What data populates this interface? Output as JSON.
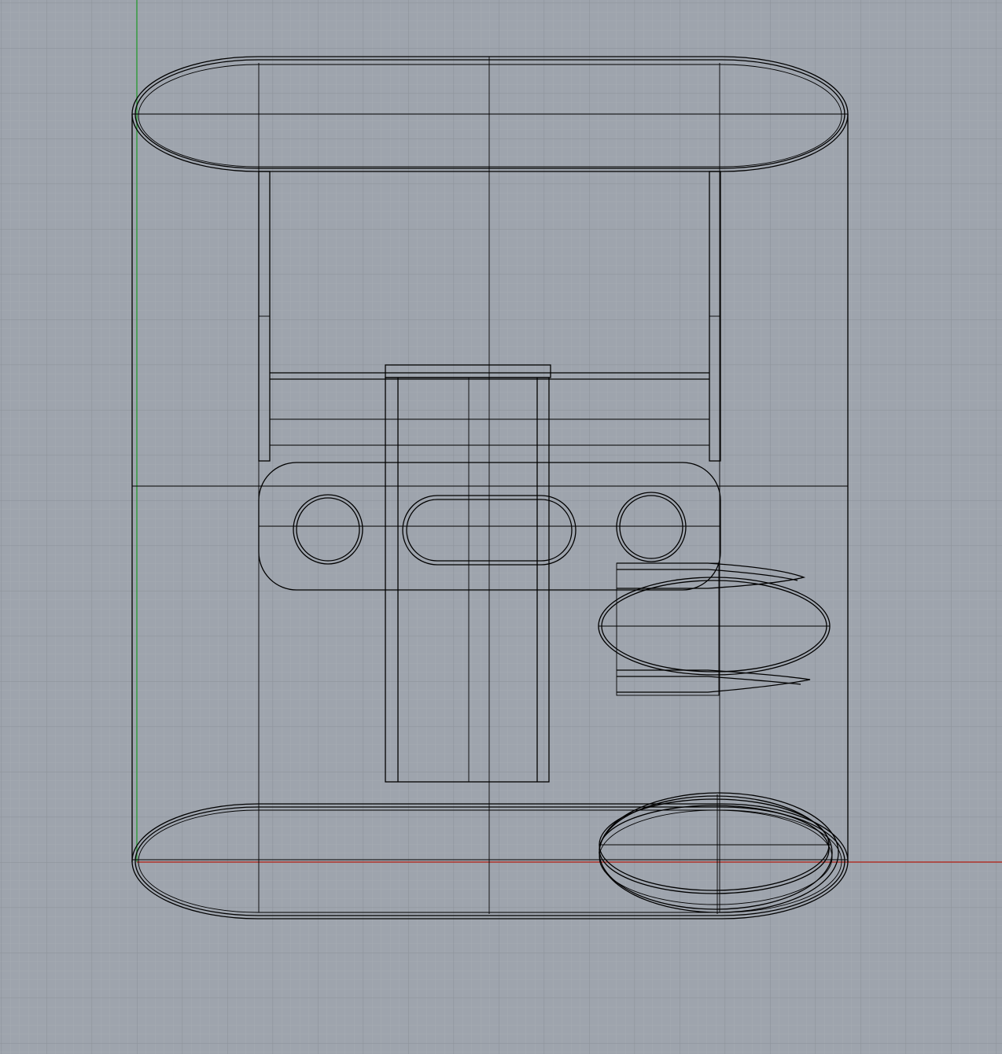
{
  "viewport": {
    "view": "top",
    "display_mode": "wireframe",
    "background_color": "#9ea4ad",
    "grid_minor_color": "#a7acb4",
    "grid_major_color": "#8e939b",
    "x_axis_color": "#b0322a",
    "y_axis_color": "#2f9a3a",
    "wire_color": "#000000"
  }
}
